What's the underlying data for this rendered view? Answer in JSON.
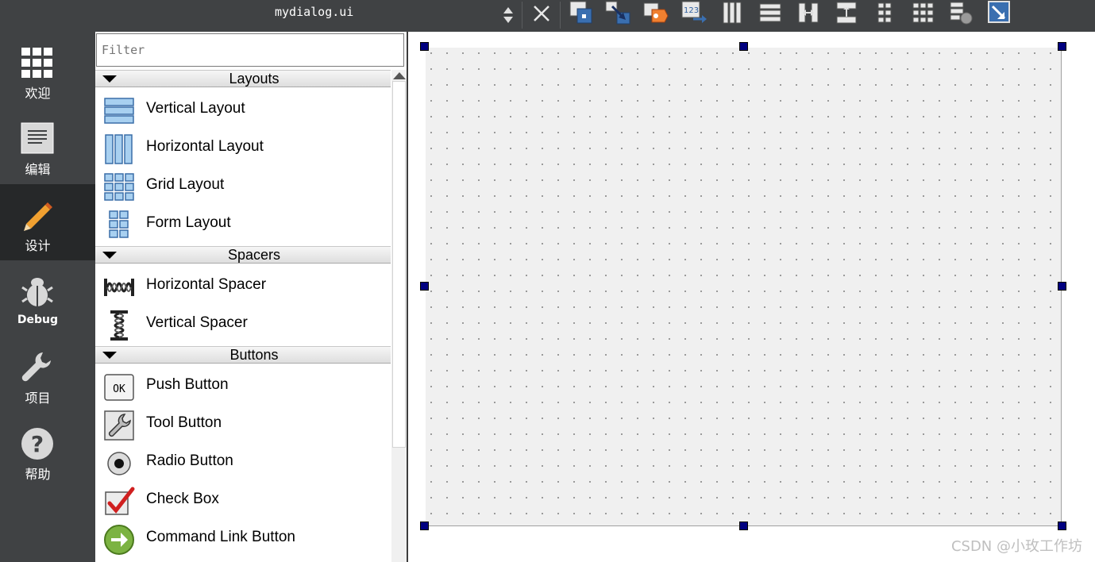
{
  "modes": [
    {
      "id": "welcome",
      "label": "欢迎",
      "icon": "grid-icon"
    },
    {
      "id": "edit",
      "label": "编辑",
      "icon": "document-icon"
    },
    {
      "id": "design",
      "label": "设计",
      "icon": "pencil-icon",
      "active": true
    },
    {
      "id": "debug",
      "label": "Debug",
      "icon": "bug-icon"
    },
    {
      "id": "projects",
      "label": "项目",
      "icon": "wrench-icon"
    },
    {
      "id": "help",
      "label": "帮助",
      "icon": "help-icon"
    }
  ],
  "editor": {
    "file_name": "mydialog.ui"
  },
  "toolbar_icons": [
    "edit-widgets-icon",
    "edit-signals-slots-icon",
    "edit-buddies-icon",
    "edit-tab-order-icon",
    "layout-horizontal-icon",
    "layout-vertical-icon",
    "layout-horizontal-splitter-icon",
    "layout-vertical-splitter-icon",
    "layout-form-icon",
    "layout-grid-icon",
    "break-layout-icon",
    "adjust-size-icon"
  ],
  "widget_box": {
    "filter_placeholder": "Filter",
    "categories": [
      {
        "name": "Layouts",
        "items": [
          "Vertical Layout",
          "Horizontal Layout",
          "Grid Layout",
          "Form Layout"
        ]
      },
      {
        "name": "Spacers",
        "items": [
          "Horizontal Spacer",
          "Vertical Spacer"
        ]
      },
      {
        "name": "Buttons",
        "items": [
          "Push Button",
          "Tool Button",
          "Radio Button",
          "Check Box",
          "Command Link Button"
        ]
      }
    ]
  },
  "colors": {
    "sidebar_bg": "#404244",
    "sidebar_active": "#262829",
    "handle": "#000080",
    "form_bg": "#f0f0f0"
  },
  "watermark": "CSDN @小玫工作坊"
}
